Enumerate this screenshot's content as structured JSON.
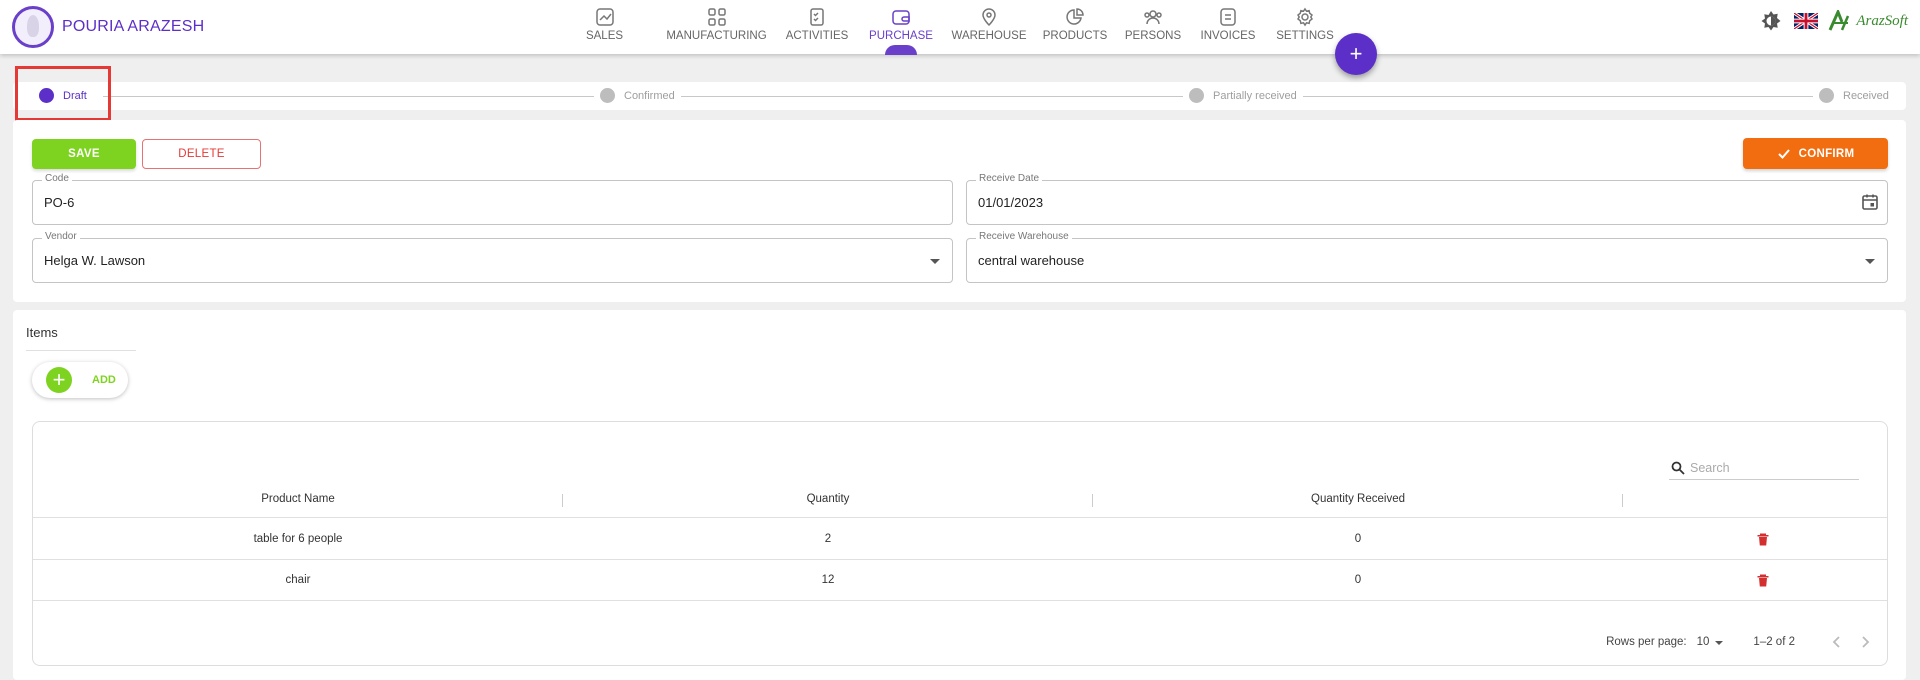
{
  "brand": {
    "name": "POURIA ARAZESH"
  },
  "nav": {
    "items": [
      {
        "label": "SALES",
        "icon": "sales-icon"
      },
      {
        "label": "MANUFACTURING",
        "icon": "manufacturing-icon"
      },
      {
        "label": "ACTIVITIES",
        "icon": "activities-icon"
      },
      {
        "label": "PURCHASE",
        "icon": "purchase-icon",
        "active": true
      },
      {
        "label": "WAREHOUSE",
        "icon": "location-pin-icon"
      },
      {
        "label": "PRODUCTS",
        "icon": "pie-chart-icon"
      },
      {
        "label": "PERSONS",
        "icon": "people-icon"
      },
      {
        "label": "INVOICES",
        "icon": "invoice-icon"
      },
      {
        "label": "SETTINGS",
        "icon": "gear-icon"
      }
    ],
    "fab": "+"
  },
  "header_right": {
    "logo_text": "ArazSoft"
  },
  "stepper": {
    "steps": [
      {
        "label": "Draft",
        "active": true
      },
      {
        "label": "Confirmed"
      },
      {
        "label": "Partially received"
      },
      {
        "label": "Received"
      }
    ]
  },
  "form": {
    "save_label": "SAVE",
    "delete_label": "DELETE",
    "confirm_label": "CONFIRM",
    "code": {
      "label": "Code",
      "value": "PO-6"
    },
    "receive_date": {
      "label": "Receive Date",
      "value": "01/01/2023"
    },
    "vendor": {
      "label": "Vendor",
      "value": "Helga W. Lawson"
    },
    "receive_warehouse": {
      "label": "Receive Warehouse",
      "value": "central warehouse"
    }
  },
  "items": {
    "title": "Items",
    "add_label": "ADD",
    "search_placeholder": "Search",
    "columns": [
      "Product Name",
      "Quantity",
      "Quantity Received"
    ],
    "rows": [
      {
        "product": "table for 6 people",
        "quantity": "2",
        "received": "0"
      },
      {
        "product": "chair",
        "quantity": "12",
        "received": "0"
      }
    ],
    "pagination": {
      "rows_per_page_label": "Rows per page:",
      "rows_per_page": "10",
      "range": "1–2 of 2"
    }
  },
  "colors": {
    "accent": "#5b2fc8",
    "save": "#7ed321",
    "confirm": "#f26d0f",
    "delete": "#e53935"
  }
}
